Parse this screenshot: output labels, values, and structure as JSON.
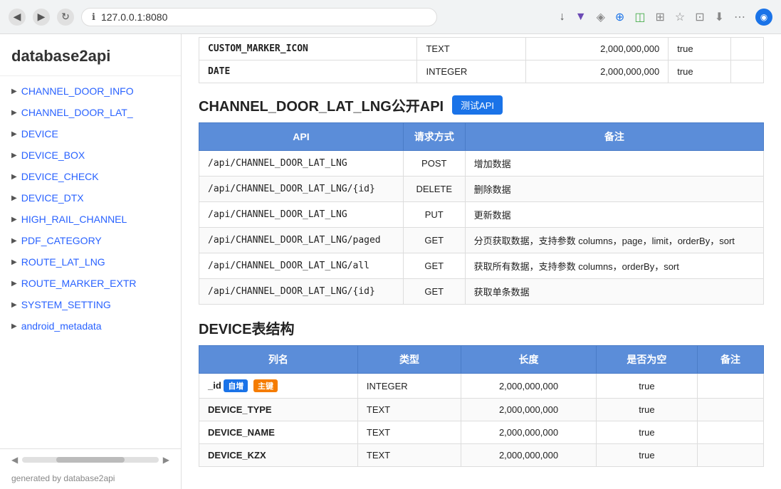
{
  "browser": {
    "url": "127.0.0.1:8080",
    "back_icon": "◀",
    "forward_icon": "▶",
    "refresh_icon": "↻",
    "info_icon": "ℹ",
    "star_icon": "☆",
    "menu_icon": "⋯"
  },
  "sidebar": {
    "title": "database2api",
    "items": [
      {
        "label": "CHANNEL_DOOR_INFO",
        "id": "channel-door-info"
      },
      {
        "label": "CHANNEL_DOOR_LAT_",
        "id": "channel-door-lat"
      },
      {
        "label": "DEVICE",
        "id": "device"
      },
      {
        "label": "DEVICE_BOX",
        "id": "device-box"
      },
      {
        "label": "DEVICE_CHECK",
        "id": "device-check"
      },
      {
        "label": "DEVICE_DTX",
        "id": "device-dtx"
      },
      {
        "label": "HIGH_RAIL_CHANNEL",
        "id": "high-rail-channel"
      },
      {
        "label": "PDF_CATEGORY",
        "id": "pdf-category"
      },
      {
        "label": "ROUTE_LAT_LNG",
        "id": "route-lat-lng"
      },
      {
        "label": "ROUTE_MARKER_EXTR",
        "id": "route-marker-extr"
      },
      {
        "label": "SYSTEM_SETTING",
        "id": "system-setting"
      },
      {
        "label": "android_metadata",
        "id": "android-metadata"
      }
    ],
    "generated_by": "generated by database2api"
  },
  "top_table": {
    "rows": [
      {
        "col1": "CUSTOM_MARKER_ICON",
        "col2": "TEXT",
        "col3": "2,000,000,000",
        "col4": "true"
      },
      {
        "col1": "DATE",
        "col2": "INTEGER",
        "col3": "2,000,000,000",
        "col4": "true"
      }
    ]
  },
  "channel_door_api": {
    "title": "CHANNEL_DOOR_LAT_LNG公开API",
    "test_btn": "测试API",
    "table_headers": [
      "API",
      "请求方式",
      "备注"
    ],
    "rows": [
      {
        "api": "/api/CHANNEL_DOOR_LAT_LNG",
        "method": "POST",
        "note": "增加数据"
      },
      {
        "api": "/api/CHANNEL_DOOR_LAT_LNG/{id}",
        "method": "DELETE",
        "note": "删除数据"
      },
      {
        "api": "/api/CHANNEL_DOOR_LAT_LNG",
        "method": "PUT",
        "note": "更新数据"
      },
      {
        "api": "/api/CHANNEL_DOOR_LAT_LNG/paged",
        "method": "GET",
        "note": "分页获取数据，支持参数 columns，page，limit，orderBy，sort"
      },
      {
        "api": "/api/CHANNEL_DOOR_LAT_LNG/all",
        "method": "GET",
        "note": "获取所有数据，支持参数 columns，orderBy，sort"
      },
      {
        "api": "/api/CHANNEL_DOOR_LAT_LNG/{id}",
        "method": "GET",
        "note": "获取单条数据"
      }
    ]
  },
  "device_struct": {
    "title": "DEVICE表结构",
    "table_headers": [
      "列名",
      "类型",
      "长度",
      "是否为空",
      "备注"
    ],
    "rows": [
      {
        "col1": "_id",
        "badges": [
          {
            "text": "自增",
            "class": "badge-blue"
          },
          {
            "text": "主键",
            "class": "badge-orange"
          }
        ],
        "col2": "INTEGER",
        "col3": "2,000,000,000",
        "col4": "true",
        "col5": ""
      },
      {
        "col1": "DEVICE_TYPE",
        "badges": [],
        "col2": "TEXT",
        "col3": "2,000,000,000",
        "col4": "true",
        "col5": ""
      },
      {
        "col1": "DEVICE_NAME",
        "badges": [],
        "col2": "TEXT",
        "col3": "2,000,000,000",
        "col4": "true",
        "col5": ""
      },
      {
        "col1": "DEVICE_KZX",
        "badges": [],
        "col2": "TEXT",
        "col3": "2,000,000,000",
        "col4": "true",
        "col5": ""
      }
    ]
  }
}
